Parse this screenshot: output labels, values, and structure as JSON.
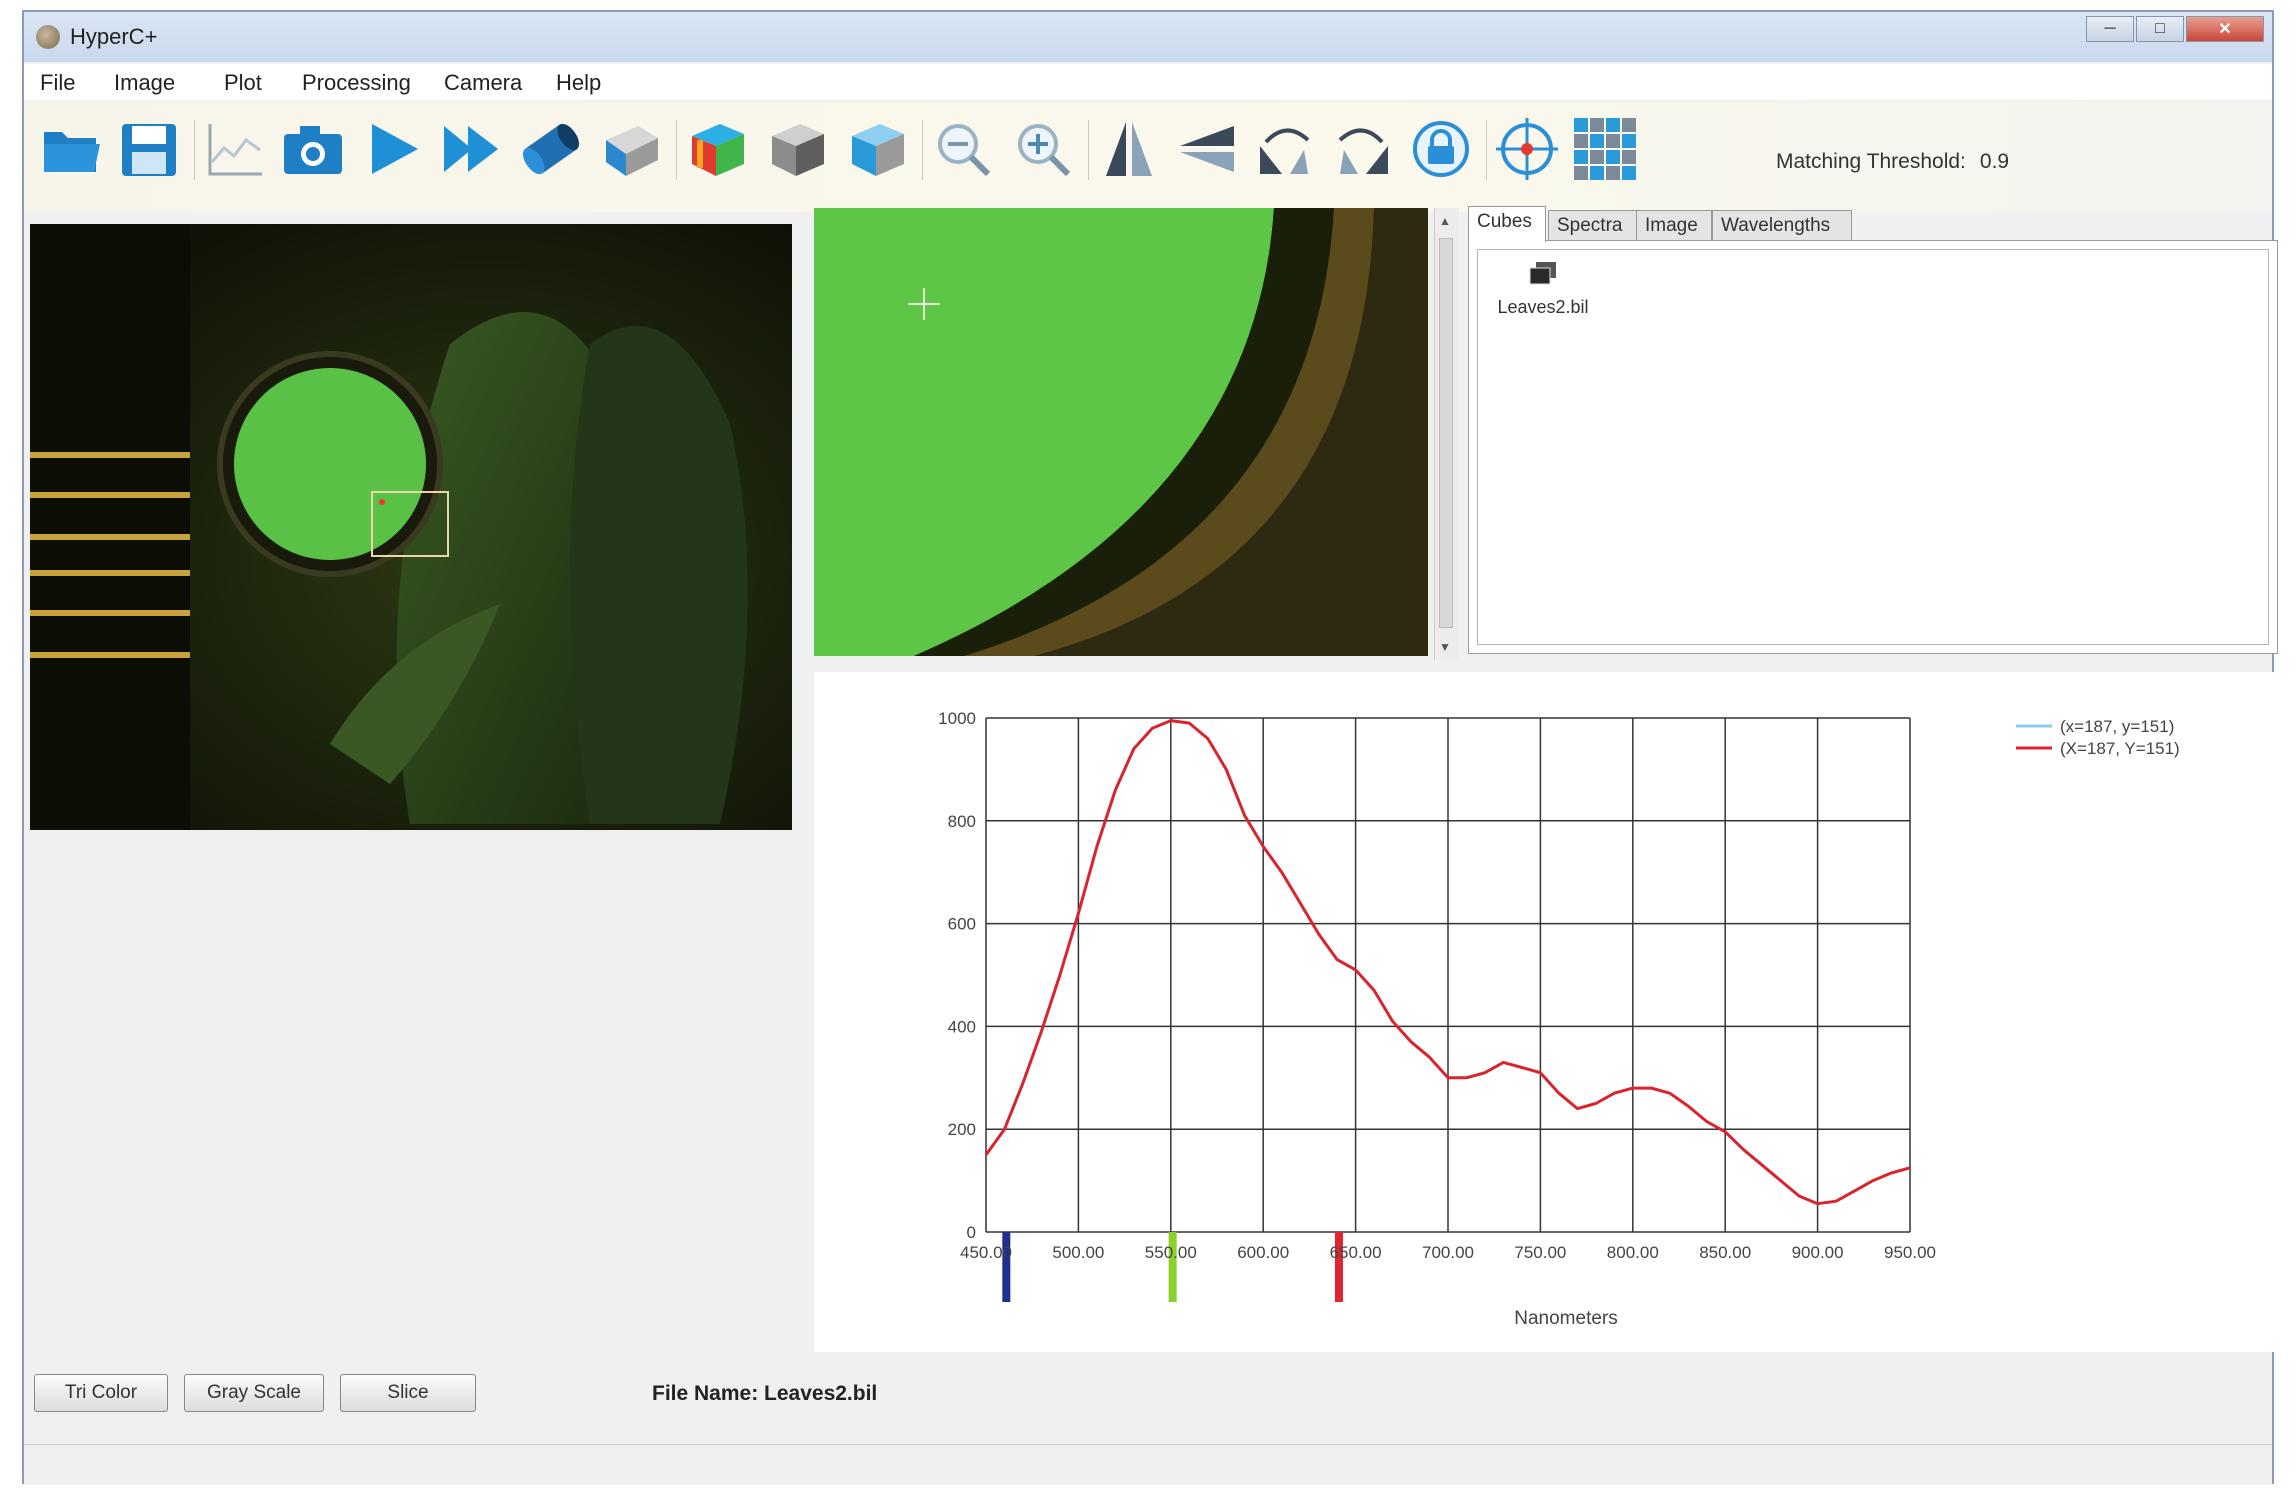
{
  "window": {
    "title": "HyperC+"
  },
  "titlebar": {
    "minimize": "─",
    "maximize": "□",
    "close": "✕"
  },
  "menu": [
    "File",
    "Image",
    "Plot",
    "Processing",
    "Camera",
    "Help"
  ],
  "toolbar": {
    "icons": [
      "folder-open-icon",
      "save-icon",
      "plot-icon",
      "camera-icon",
      "play-icon",
      "fast-forward-icon",
      "cylinder-icon",
      "cube-icon",
      "rgb-cube-icon",
      "gray-cube-icon",
      "blue-cube-icon",
      "zoom-out-icon",
      "zoom-in-icon",
      "flip-vertical-icon",
      "flip-horizontal-icon",
      "rotate-left-icon",
      "rotate-right-icon",
      "lock-icon",
      "crosshair-icon",
      "grid-icon"
    ],
    "threshold_label": "Matching Threshold:",
    "threshold_value": "0.9"
  },
  "tabs": [
    "Cubes",
    "Spectra",
    "Image",
    "Wavelengths"
  ],
  "cubes": {
    "file_label": "Leaves2.bil"
  },
  "legend": [
    "(x=187, y=151)",
    "(X=187, Y=151)"
  ],
  "buttons": {
    "tricolor": "Tri Color",
    "grayscale": "Gray Scale",
    "slice": "Slice"
  },
  "file_name": "File Name: Leaves2.bil",
  "colors": {
    "spectrum": "#d9232e",
    "marker_blue": "#1e2f8e",
    "marker_green": "#8cd12a",
    "marker_red": "#e02432",
    "legend_cyan": "#8ecfe8"
  },
  "chart_data": {
    "type": "line",
    "xlabel": "Nanometers",
    "ylabel": "",
    "xlim": [
      450,
      950
    ],
    "ylim": [
      0,
      1000
    ],
    "x_ticks": [
      "450.00",
      "500.00",
      "550.00",
      "600.00",
      "650.00",
      "700.00",
      "750.00",
      "800.00",
      "850.00",
      "900.00",
      "950.00"
    ],
    "y_ticks": [
      "0",
      "200",
      "400",
      "600",
      "800",
      "1000"
    ],
    "grid": true,
    "legend_position": "top-right",
    "series": [
      {
        "name": "(X=187, Y=151)",
        "x": [
          450,
          460,
          470,
          480,
          490,
          500,
          510,
          520,
          530,
          540,
          550,
          560,
          570,
          580,
          590,
          600,
          610,
          620,
          630,
          640,
          650,
          660,
          670,
          680,
          690,
          700,
          710,
          720,
          730,
          740,
          750,
          760,
          770,
          780,
          790,
          800,
          810,
          820,
          830,
          840,
          850,
          860,
          870,
          880,
          890,
          900,
          910,
          920,
          930,
          940,
          950
        ],
        "y": [
          150,
          200,
          290,
          390,
          500,
          620,
          750,
          860,
          940,
          980,
          995,
          990,
          960,
          900,
          810,
          750,
          700,
          640,
          580,
          530,
          510,
          470,
          410,
          370,
          340,
          300,
          300,
          310,
          330,
          320,
          310,
          270,
          240,
          250,
          270,
          280,
          280,
          270,
          245,
          215,
          195,
          160,
          130,
          100,
          70,
          55,
          60,
          80,
          100,
          115,
          125
        ]
      }
    ],
    "band_markers": [
      {
        "x": 461,
        "color": "#1e2f8e"
      },
      {
        "x": 551,
        "color": "#8cd12a"
      },
      {
        "x": 641,
        "color": "#e02432"
      }
    ]
  }
}
